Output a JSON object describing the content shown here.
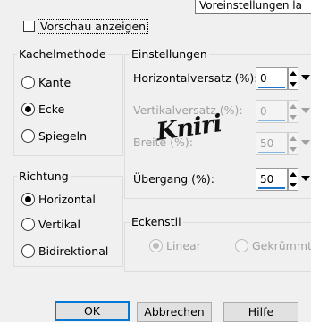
{
  "tooltip": {
    "text": "Voreinstellungen la"
  },
  "preview": {
    "label": "Vorschau anzeigen",
    "checked": false
  },
  "tiling_method": {
    "title": "Kachelmethode",
    "options": [
      {
        "label": "Kante",
        "checked": false
      },
      {
        "label": "Ecke",
        "checked": true
      },
      {
        "label": "Spiegeln",
        "checked": false
      }
    ]
  },
  "direction": {
    "title": "Richtung",
    "options": [
      {
        "label": "Horizontal",
        "checked": true
      },
      {
        "label": "Vertikal",
        "checked": false
      },
      {
        "label": "Bidirektional",
        "checked": false
      }
    ]
  },
  "settings": {
    "title": "Einstellungen",
    "fields": [
      {
        "label": "Horizontalversatz (%):",
        "value": "0",
        "enabled": true
      },
      {
        "label": "Vertikalversatz (%):",
        "value": "0",
        "enabled": false
      },
      {
        "label": "Breite (%):",
        "value": "50",
        "enabled": false
      },
      {
        "label": "Übergang (%):",
        "value": "50",
        "enabled": true
      }
    ]
  },
  "corner_style": {
    "title": "Eckenstil",
    "options": [
      {
        "label": "Linear",
        "checked": true,
        "enabled": false
      },
      {
        "label": "Gekrümmt",
        "checked": false,
        "enabled": false
      }
    ]
  },
  "watermark": {
    "text": "Kniri"
  },
  "buttons": {
    "ok": "OK",
    "cancel": "Abbrechen",
    "help": "Hilfe"
  },
  "colors": {
    "accent": "#0078d7",
    "spin_underline": "#1a73c8",
    "disabled_text": "#a0a0a0"
  }
}
